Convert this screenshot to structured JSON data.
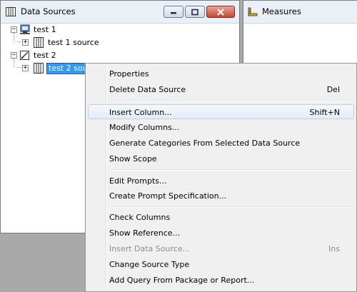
{
  "data_sources_pane": {
    "title": "Data Sources",
    "tree": [
      {
        "label": "test 1",
        "children": [
          {
            "label": "test 1 source"
          }
        ]
      },
      {
        "label": "test 2",
        "children": [
          {
            "label": "test 2 source",
            "visible_label": "test 2 sour",
            "selected": true
          }
        ]
      }
    ]
  },
  "measures_pane": {
    "title": "Measures"
  },
  "context_menu": {
    "items": [
      {
        "label": "Properties",
        "shortcut": ""
      },
      {
        "label": "Delete Data Source",
        "shortcut": "Del"
      },
      {
        "label": "Insert Column...",
        "shortcut": "Shift+N",
        "highlighted": true
      },
      {
        "label": "Modify Columns...",
        "shortcut": ""
      },
      {
        "label": "Generate Categories From Selected Data Source",
        "shortcut": ""
      },
      {
        "label": "Show Scope",
        "shortcut": ""
      },
      {
        "label": "Edit Prompts...",
        "shortcut": ""
      },
      {
        "label": "Create Prompt Specification...",
        "shortcut": ""
      },
      {
        "label": "Check Columns",
        "shortcut": ""
      },
      {
        "label": "Show Reference...",
        "shortcut": ""
      },
      {
        "label": "Insert Data Source...",
        "shortcut": "Ins",
        "disabled": true
      },
      {
        "label": "Change Source Type",
        "shortcut": ""
      },
      {
        "label": "Add Query From Package or Report...",
        "shortcut": ""
      }
    ]
  }
}
